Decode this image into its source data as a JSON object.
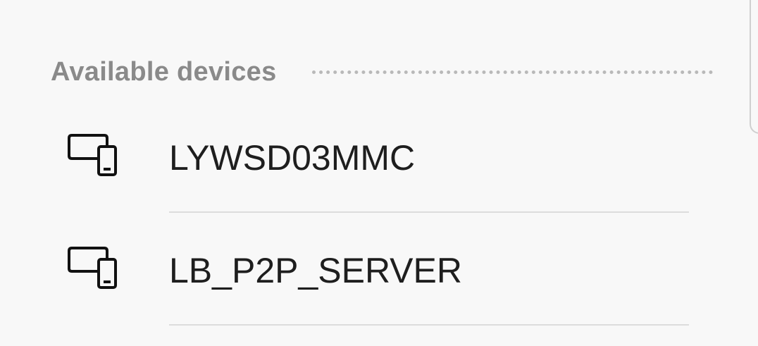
{
  "section": {
    "title": "Available devices"
  },
  "devices": [
    {
      "name": "LYWSD03MMC",
      "icon": "devices-icon"
    },
    {
      "name": "LB_P2P_SERVER",
      "icon": "devices-icon"
    }
  ]
}
